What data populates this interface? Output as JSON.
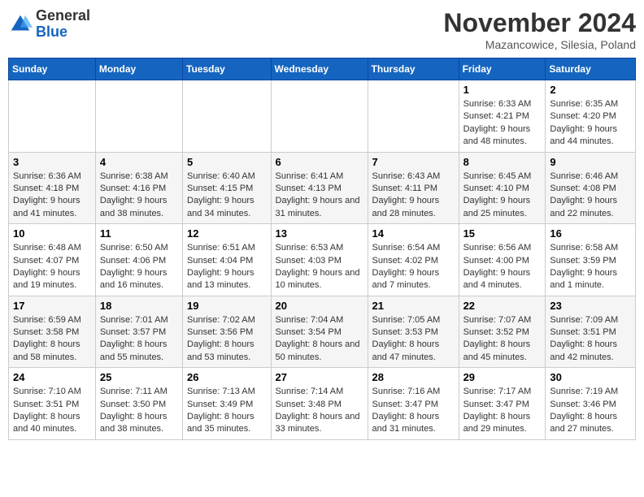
{
  "header": {
    "logo": {
      "general": "General",
      "blue": "Blue"
    },
    "title": "November 2024",
    "subtitle": "Mazancowice, Silesia, Poland"
  },
  "weekdays": [
    "Sunday",
    "Monday",
    "Tuesday",
    "Wednesday",
    "Thursday",
    "Friday",
    "Saturday"
  ],
  "weeks": [
    [
      {
        "day": "",
        "info": ""
      },
      {
        "day": "",
        "info": ""
      },
      {
        "day": "",
        "info": ""
      },
      {
        "day": "",
        "info": ""
      },
      {
        "day": "",
        "info": ""
      },
      {
        "day": "1",
        "info": "Sunrise: 6:33 AM\nSunset: 4:21 PM\nDaylight: 9 hours and 48 minutes."
      },
      {
        "day": "2",
        "info": "Sunrise: 6:35 AM\nSunset: 4:20 PM\nDaylight: 9 hours and 44 minutes."
      }
    ],
    [
      {
        "day": "3",
        "info": "Sunrise: 6:36 AM\nSunset: 4:18 PM\nDaylight: 9 hours and 41 minutes."
      },
      {
        "day": "4",
        "info": "Sunrise: 6:38 AM\nSunset: 4:16 PM\nDaylight: 9 hours and 38 minutes."
      },
      {
        "day": "5",
        "info": "Sunrise: 6:40 AM\nSunset: 4:15 PM\nDaylight: 9 hours and 34 minutes."
      },
      {
        "day": "6",
        "info": "Sunrise: 6:41 AM\nSunset: 4:13 PM\nDaylight: 9 hours and 31 minutes."
      },
      {
        "day": "7",
        "info": "Sunrise: 6:43 AM\nSunset: 4:11 PM\nDaylight: 9 hours and 28 minutes."
      },
      {
        "day": "8",
        "info": "Sunrise: 6:45 AM\nSunset: 4:10 PM\nDaylight: 9 hours and 25 minutes."
      },
      {
        "day": "9",
        "info": "Sunrise: 6:46 AM\nSunset: 4:08 PM\nDaylight: 9 hours and 22 minutes."
      }
    ],
    [
      {
        "day": "10",
        "info": "Sunrise: 6:48 AM\nSunset: 4:07 PM\nDaylight: 9 hours and 19 minutes."
      },
      {
        "day": "11",
        "info": "Sunrise: 6:50 AM\nSunset: 4:06 PM\nDaylight: 9 hours and 16 minutes."
      },
      {
        "day": "12",
        "info": "Sunrise: 6:51 AM\nSunset: 4:04 PM\nDaylight: 9 hours and 13 minutes."
      },
      {
        "day": "13",
        "info": "Sunrise: 6:53 AM\nSunset: 4:03 PM\nDaylight: 9 hours and 10 minutes."
      },
      {
        "day": "14",
        "info": "Sunrise: 6:54 AM\nSunset: 4:02 PM\nDaylight: 9 hours and 7 minutes."
      },
      {
        "day": "15",
        "info": "Sunrise: 6:56 AM\nSunset: 4:00 PM\nDaylight: 9 hours and 4 minutes."
      },
      {
        "day": "16",
        "info": "Sunrise: 6:58 AM\nSunset: 3:59 PM\nDaylight: 9 hours and 1 minute."
      }
    ],
    [
      {
        "day": "17",
        "info": "Sunrise: 6:59 AM\nSunset: 3:58 PM\nDaylight: 8 hours and 58 minutes."
      },
      {
        "day": "18",
        "info": "Sunrise: 7:01 AM\nSunset: 3:57 PM\nDaylight: 8 hours and 55 minutes."
      },
      {
        "day": "19",
        "info": "Sunrise: 7:02 AM\nSunset: 3:56 PM\nDaylight: 8 hours and 53 minutes."
      },
      {
        "day": "20",
        "info": "Sunrise: 7:04 AM\nSunset: 3:54 PM\nDaylight: 8 hours and 50 minutes."
      },
      {
        "day": "21",
        "info": "Sunrise: 7:05 AM\nSunset: 3:53 PM\nDaylight: 8 hours and 47 minutes."
      },
      {
        "day": "22",
        "info": "Sunrise: 7:07 AM\nSunset: 3:52 PM\nDaylight: 8 hours and 45 minutes."
      },
      {
        "day": "23",
        "info": "Sunrise: 7:09 AM\nSunset: 3:51 PM\nDaylight: 8 hours and 42 minutes."
      }
    ],
    [
      {
        "day": "24",
        "info": "Sunrise: 7:10 AM\nSunset: 3:51 PM\nDaylight: 8 hours and 40 minutes."
      },
      {
        "day": "25",
        "info": "Sunrise: 7:11 AM\nSunset: 3:50 PM\nDaylight: 8 hours and 38 minutes."
      },
      {
        "day": "26",
        "info": "Sunrise: 7:13 AM\nSunset: 3:49 PM\nDaylight: 8 hours and 35 minutes."
      },
      {
        "day": "27",
        "info": "Sunrise: 7:14 AM\nSunset: 3:48 PM\nDaylight: 8 hours and 33 minutes."
      },
      {
        "day": "28",
        "info": "Sunrise: 7:16 AM\nSunset: 3:47 PM\nDaylight: 8 hours and 31 minutes."
      },
      {
        "day": "29",
        "info": "Sunrise: 7:17 AM\nSunset: 3:47 PM\nDaylight: 8 hours and 29 minutes."
      },
      {
        "day": "30",
        "info": "Sunrise: 7:19 AM\nSunset: 3:46 PM\nDaylight: 8 hours and 27 minutes."
      }
    ]
  ]
}
